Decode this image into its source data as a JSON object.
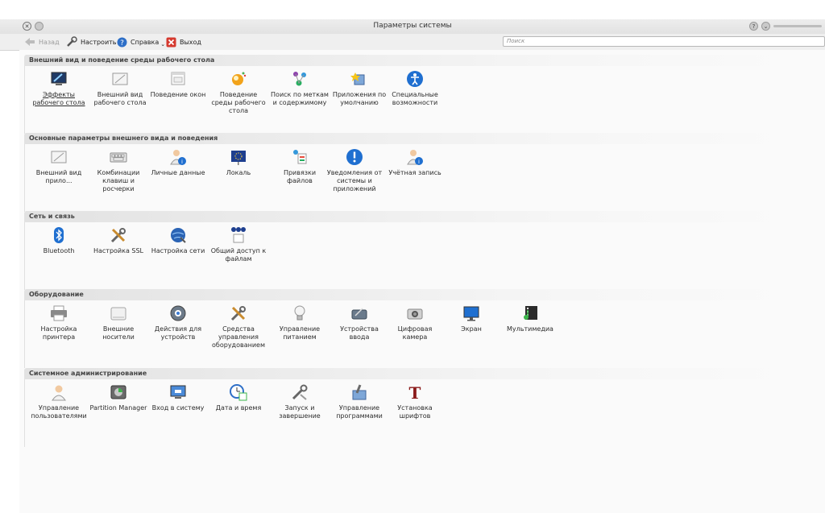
{
  "window": {
    "title": "Параметры системы"
  },
  "toolbar": {
    "back_label": "Назад",
    "configure_label": "Настроить",
    "help_label": "Справка",
    "exit_label": "Выход",
    "search_placeholder": "Поиск"
  },
  "groups": [
    {
      "title": "Внешний вид и поведение среды рабочего стола",
      "items": [
        {
          "label": "Эффекты рабочего стола",
          "icon": "desktop-effects-icon"
        },
        {
          "label": "Внешний вид рабочего стола",
          "icon": "workspace-appearance-icon"
        },
        {
          "label": "Поведение окон",
          "icon": "window-behavior-icon"
        },
        {
          "label": "Поведение среды рабочего стола",
          "icon": "workspace-behavior-icon"
        },
        {
          "label": "Поиск по меткам и содержимому",
          "icon": "desktop-search-icon"
        },
        {
          "label": "Приложения по умолчанию",
          "icon": "default-apps-icon"
        },
        {
          "label": "Специальные возможности",
          "icon": "accessibility-icon"
        }
      ]
    },
    {
      "title": "Основные параметры внешнего вида и поведения",
      "items": [
        {
          "label": "Внешний вид прило...",
          "icon": "app-appearance-icon"
        },
        {
          "label": "Комбинации клавиш и росчерки",
          "icon": "keyboard-shortcuts-icon"
        },
        {
          "label": "Личные данные",
          "icon": "personal-info-icon"
        },
        {
          "label": "Локаль",
          "icon": "locale-icon"
        },
        {
          "label": "Привязки файлов",
          "icon": "file-associations-icon"
        },
        {
          "label": "Уведомления от системы и приложений",
          "icon": "notifications-icon"
        },
        {
          "label": "Учётная запись",
          "icon": "account-icon"
        }
      ]
    },
    {
      "title": "Сеть и связь",
      "items": [
        {
          "label": "Bluetooth",
          "icon": "bluetooth-icon"
        },
        {
          "label": "Настройка SSL",
          "icon": "ssl-tools-icon"
        },
        {
          "label": "Настройка сети",
          "icon": "network-settings-icon"
        },
        {
          "label": "Общий доступ к файлам",
          "icon": "file-sharing-icon"
        }
      ]
    },
    {
      "title": "Оборудование",
      "items": [
        {
          "label": "Настройка принтера",
          "icon": "printer-icon"
        },
        {
          "label": "Внешние носители",
          "icon": "removable-media-icon"
        },
        {
          "label": "Действия для устройств",
          "icon": "device-actions-icon"
        },
        {
          "label": "Средства управления оборудованием",
          "icon": "hardware-tools-icon"
        },
        {
          "label": "Управление питанием",
          "icon": "power-management-icon"
        },
        {
          "label": "Устройства ввода",
          "icon": "input-devices-icon"
        },
        {
          "label": "Цифровая камера",
          "icon": "camera-icon"
        },
        {
          "label": "Экран",
          "icon": "display-icon"
        },
        {
          "label": "Мультимедиа",
          "icon": "multimedia-icon"
        }
      ]
    },
    {
      "title": "Системное администрирование",
      "items": [
        {
          "label": "Управление пользователями",
          "icon": "user-management-icon"
        },
        {
          "label": "Partition Manager",
          "icon": "partition-manager-icon"
        },
        {
          "label": "Вход в систему",
          "icon": "login-screen-icon"
        },
        {
          "label": "Дата и время",
          "icon": "date-time-icon"
        },
        {
          "label": "Запуск и завершение",
          "icon": "startup-shutdown-icon"
        },
        {
          "label": "Управление программами",
          "icon": "software-management-icon"
        },
        {
          "label": "Установка шрифтов",
          "icon": "font-installer-icon"
        }
      ]
    }
  ]
}
